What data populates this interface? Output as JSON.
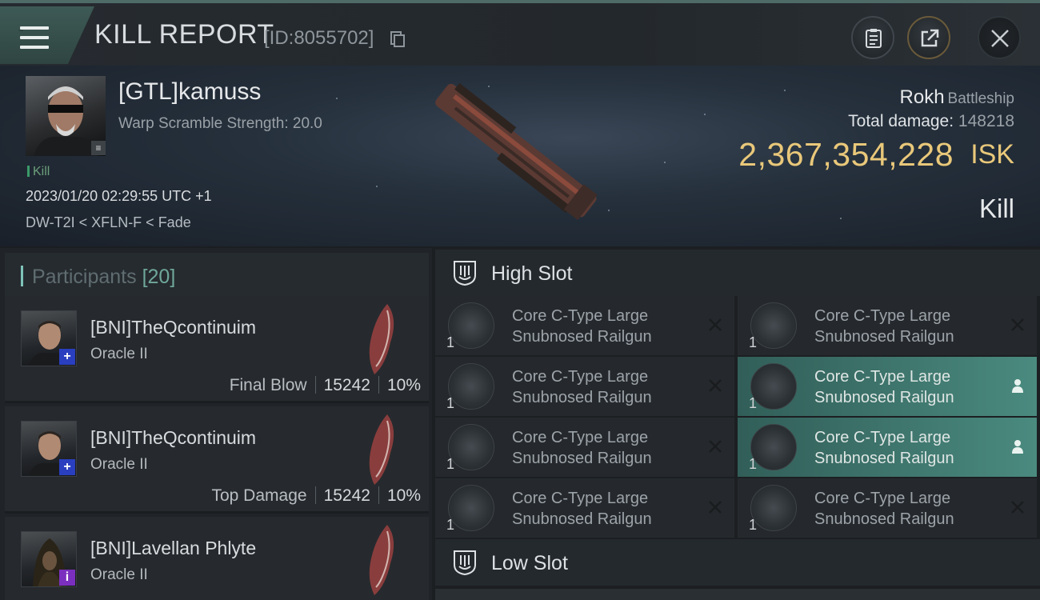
{
  "header": {
    "title": "KILL REPORT",
    "report_id": "[ID:8055702]",
    "icons": [
      "menu-icon",
      "copy-icon",
      "clipboard-icon",
      "share-icon",
      "close-icon"
    ]
  },
  "victim": {
    "name": "[GTL]kamuss",
    "warp_scramble": "Warp Scramble Strength: 20.0",
    "kill_tag": "Kill",
    "timestamp": "2023/01/20 02:29:55 UTC +1",
    "location": "DW-T2I < XFLN-F < Fade",
    "ship_name": "Rokh",
    "ship_class": "Battleship",
    "total_damage_label": "Total damage:",
    "total_damage_value": "148218",
    "isk_value": "2,367,354,228",
    "isk_unit": "ISK",
    "result": "Kill"
  },
  "participants": {
    "title": "Participants",
    "count": "[20]",
    "rows": [
      {
        "name": "[BNI]TheQcontinuim",
        "ship": "Oracle II",
        "role": "Final Blow",
        "damage": "15242",
        "percent": "10%",
        "badge": "+",
        "badge_color": "#2a3fbf"
      },
      {
        "name": "[BNI]TheQcontinuim",
        "ship": "Oracle II",
        "role": "Top Damage",
        "damage": "15242",
        "percent": "10%",
        "badge": "+",
        "badge_color": "#2a3fbf"
      },
      {
        "name": "[BNI]Lavellan Phlyte",
        "ship": "Oracle II",
        "role": "",
        "damage": "",
        "percent": "",
        "badge": "i",
        "badge_color": "#7b2fbf"
      }
    ]
  },
  "slots": {
    "high_slot_title": "High Slot",
    "low_slot_title": "Low Slot",
    "high_items": [
      {
        "qty": "1",
        "line1": "Core C-Type Large",
        "line2": "Snubnosed Railgun",
        "status": "destroyed"
      },
      {
        "qty": "1",
        "line1": "Core C-Type Large",
        "line2": "Snubnosed Railgun",
        "status": "destroyed"
      },
      {
        "qty": "1",
        "line1": "Core C-Type Large",
        "line2": "Snubnosed Railgun",
        "status": "destroyed"
      },
      {
        "qty": "1",
        "line1": "Core C-Type Large",
        "line2": "Snubnosed Railgun",
        "status": "dropped"
      },
      {
        "qty": "1",
        "line1": "Core C-Type Large",
        "line2": "Snubnosed Railgun",
        "status": "destroyed"
      },
      {
        "qty": "1",
        "line1": "Core C-Type Large",
        "line2": "Snubnosed Railgun",
        "status": "dropped"
      },
      {
        "qty": "1",
        "line1": "Core C-Type Large",
        "line2": "Snubnosed Railgun",
        "status": "destroyed"
      },
      {
        "qty": "1",
        "line1": "Core C-Type Large",
        "line2": "Snubnosed Railgun",
        "status": "destroyed"
      }
    ]
  },
  "colors": {
    "accent_teal": "#4a8a7f",
    "isk_gold": "#e9c87a",
    "background": "#1b1e21"
  }
}
